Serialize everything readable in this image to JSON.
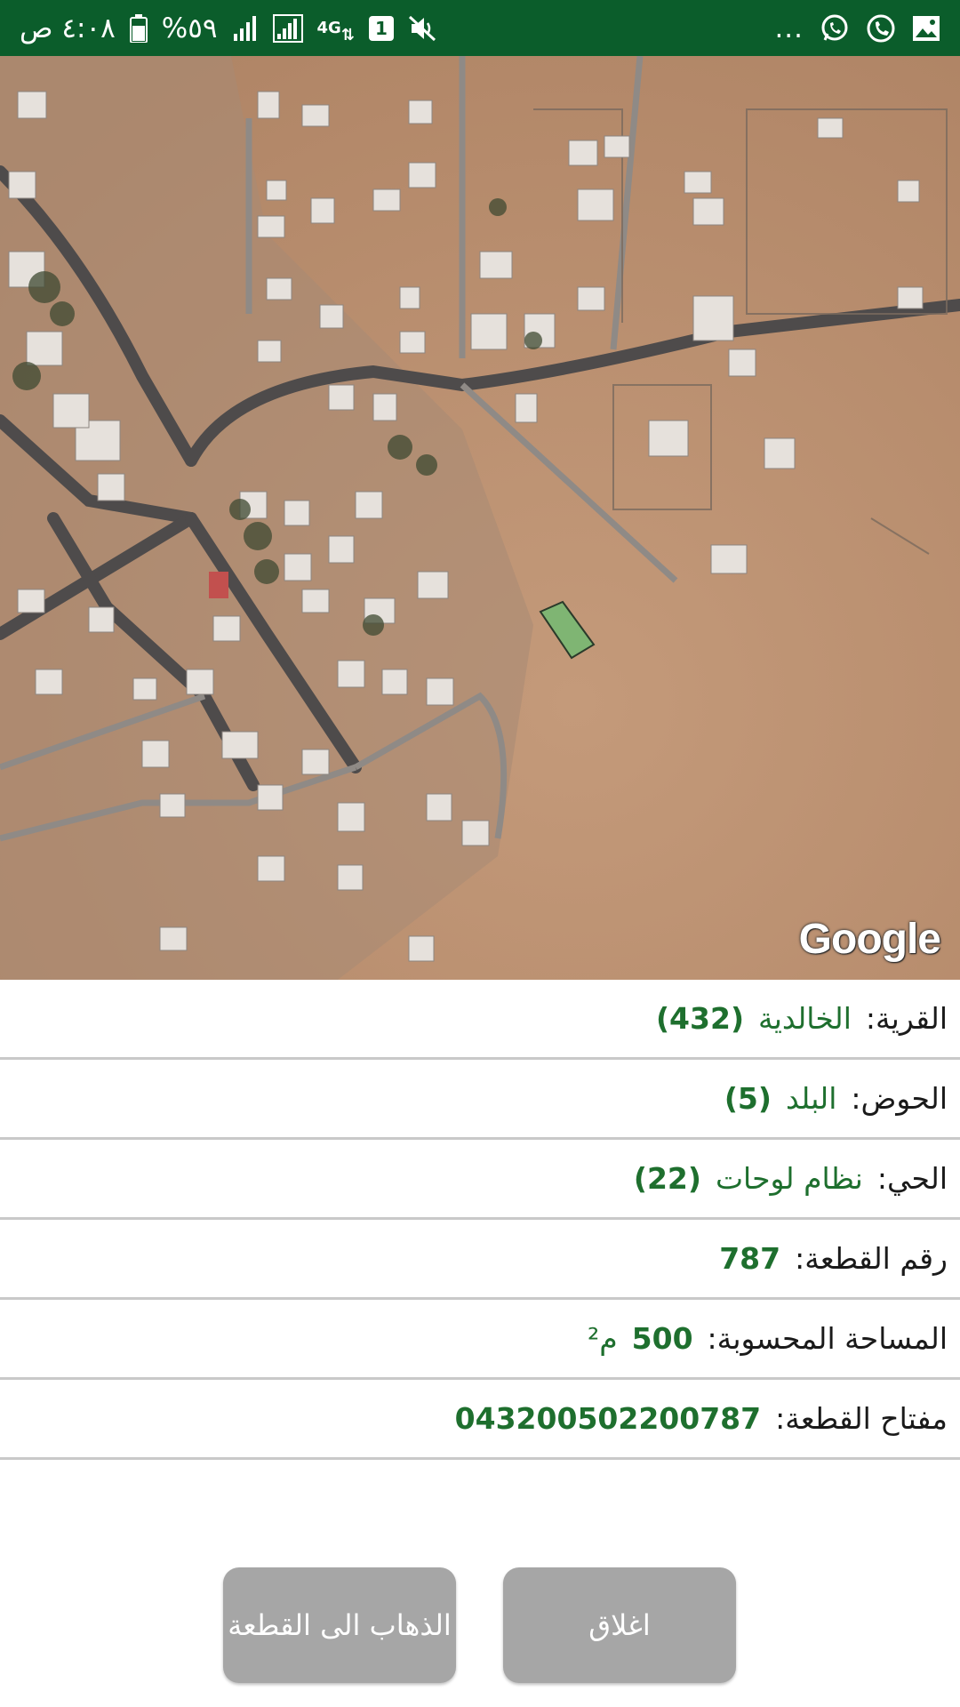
{
  "status_bar": {
    "time": "٤:٠٨ ص",
    "battery_percent": "%٥٩",
    "network_type": "4G",
    "sim_slot": "1",
    "more": "...",
    "icons": [
      "mute-icon",
      "sim-1-icon",
      "4g-icon",
      "signal-icon",
      "signal-icon",
      "battery-icon",
      "image-icon",
      "phone-icon",
      "whatsapp-icon"
    ]
  },
  "map": {
    "provider_logo": "Google",
    "parcel_color": "#7fb573"
  },
  "parcel_info": [
    {
      "label": "القرية:",
      "name": "الخالدية",
      "value": "(432)"
    },
    {
      "label": "الحوض:",
      "name": "البلد",
      "value": "(5)"
    },
    {
      "label": "الحي:",
      "name": "نظام لوحات",
      "value": "(22)"
    },
    {
      "label": "رقم القطعة:",
      "name": "",
      "value": "787"
    },
    {
      "label": "المساحة المحسوبة:",
      "name": "م²",
      "value": "500"
    },
    {
      "label": "مفتاح القطعة:",
      "name": "",
      "value": "043200502200787"
    }
  ],
  "buttons": {
    "go_to_parcel": "الذهاب الى القطعة",
    "close": "اغلاق"
  },
  "colors": {
    "status_bar": "#0b5d2b",
    "value_text": "#1e6f2e",
    "button_bg": "#a6a6a6",
    "divider": "#c9c9c9"
  }
}
